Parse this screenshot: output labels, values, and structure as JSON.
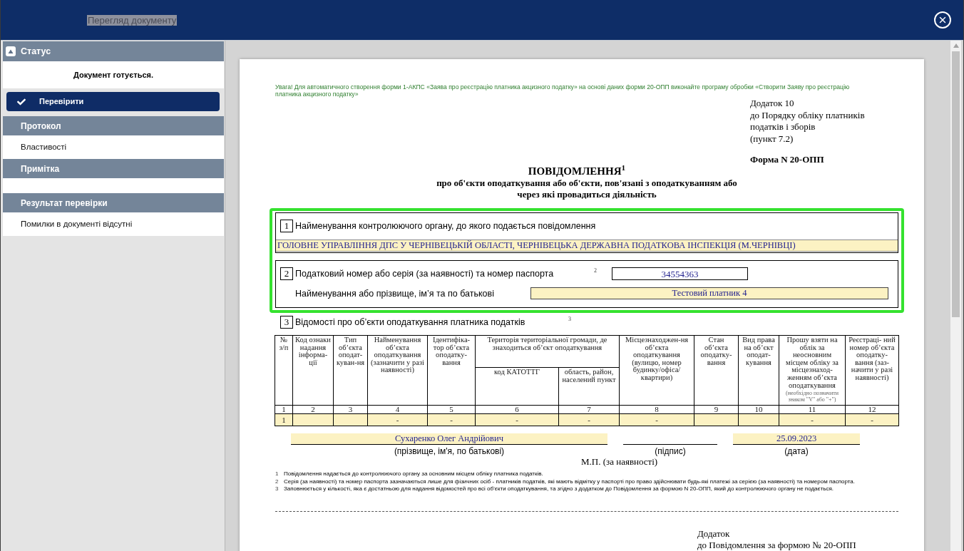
{
  "window": {
    "title": "Перегляд документу",
    "title_selected": true
  },
  "sidebar": {
    "status": {
      "title": "Статус",
      "expanded": true,
      "message": "Документ готується."
    },
    "check_button": {
      "label": "Перевірити"
    },
    "sections": [
      {
        "title": "Протокол",
        "item": "Властивості"
      },
      {
        "title": "Примітка"
      },
      {
        "title": "Результат перевірки",
        "item": "Помилки в документі відсутні"
      }
    ]
  },
  "document": {
    "notice": "Увага! Для автоматичного створення форми 1-АКПС «Заява про реєстрацію платника акцизного податку» на основі даних форми 20-ОПП виконайте програму обробки «Створити Заяву про реєстрацію платника акцизного податку»",
    "annex_lines": [
      "Додаток 10",
      "до Порядку обліку платників",
      "податків і зборів",
      "(пункт 7.2)"
    ],
    "form_number": "Форма N 20-ОПП",
    "title": "ПОВІДОМЛЕННЯ$^{1}$",
    "subtitle": "про об'єкти оподаткування або об'єкти, пов'язані з оподаткуванням або через які провадиться діяльність",
    "recipient_block": {
      "highlighted": true,
      "authority": {
        "number": "1",
        "label": "Найменування контролюючого органу, до якого подається повідомлення",
        "value": "ГОЛОВНЕ УПРАВЛІННЯ ДПС У ЧЕРНІВЕЦЬКІЙ ОБЛАСТІ, ЧЕРНІВЕЦЬКА ДЕРЖАВНА ПОДАТКОВА ІНСПЕКЦІЯ (М.ЧЕРНІВЦІ)"
      },
      "taxpayer": {
        "number": "2",
        "tax_id": {
          "label": "Податковий номер або серія (за наявності) та номер паспорта",
          "note": "2",
          "value": "34554363"
        },
        "name": {
          "label": "Найменування або прізвище, ім’я та по батькові",
          "value": "Тестовий платник 4"
        }
      }
    },
    "objects": {
      "number": "3",
      "label": "Відомості про об’єкти оподаткування платника податків",
      "note": "3",
      "table": {
        "header_rows": [
          [
            {
              "label": "№ з/п",
              "rowspan": 2
            },
            {
              "label": "Код ознаки надання інформа-ції",
              "rowspan": 2
            },
            {
              "label": "Тип об’єкта оподат-куван-ня",
              "rowspan": 2
            },
            {
              "label": "Найменування об’єкта оподаткування (зазначити у разі наявності)",
              "rowspan": 2
            },
            {
              "label": "Ідентифіка-тор об’єкта оподатку-вання",
              "rowspan": 2
            },
            {
              "label": "Територія територіальної громади, де знаходиться об’єкт оподаткування",
              "colspan": 2
            },
            {
              "label": "Місцезнаходжен-ня об’єкта оподаткування (вулицю, номер будинку/офіса/ квартири)",
              "rowspan": 2
            },
            {
              "label": "Стан об’єкта оподатку-вання",
              "rowspan": 2
            },
            {
              "label": "Вид права на об’єкт оподат-кування",
              "rowspan": 2
            },
            {
              "label": "Прошу взяти на облік за неосновним місцем обліку за місцезнаход-женням об’єкта оподаткування",
              "note": "(необхідно позначити знаком \"V\" або \"+\")",
              "rowspan": 2
            },
            {
              "label": "Реєстраці- ний номер об’єкта оподатку-вання (заз-начити у разі наявності)",
              "rowspan": 2
            }
          ],
          [
            {
              "label": "код КАТОТТГ"
            },
            {
              "label": "область, район, населений пункт"
            }
          ]
        ],
        "column_numbers": [
          "1",
          "2",
          "3",
          "4",
          "5",
          "6",
          "7",
          "8",
          "9",
          "10",
          "11",
          "12"
        ],
        "rows": [
          {
            "cells": [
              "1",
              null,
              null,
              "-",
              "-",
              "-",
              "-",
              "-",
              null,
              null,
              "-",
              "-"
            ]
          }
        ]
      }
    },
    "signatures": {
      "name": {
        "value": "Сухаренко Олег Андрійович",
        "caption": "(прізвище, ім'я, по батькові)"
      },
      "signature": {
        "caption": "(підпис)"
      },
      "date": {
        "value": "25.09.2023",
        "caption": "(дата)"
      },
      "stamp": "М.П. (за наявності)"
    },
    "footnotes": [
      {
        "mark": "1",
        "text": "Повідомлення надається до контролюючого органу за основним місцем обліку платника податків."
      },
      {
        "mark": "2",
        "text": "Серія (за наявності) та номер паспорта зазначаються лише для фізичних осіб - платників податків, які мають відмітку у паспорті про право здійснювати будь-які платежі за серією (за наявності) та номером паспорта."
      },
      {
        "mark": "3",
        "text": "Заповнюється у кількості, яка є достатньою для надання відомостей про всі об’єкти оподаткування, та згідно з додатком до Повідомлення за формою N 20-ОПП, який до контролюючого органу не подається."
      }
    ],
    "appendix_lines": [
      "Додаток",
      "до Повідомлення за формою № 20-ОПП"
    ]
  }
}
